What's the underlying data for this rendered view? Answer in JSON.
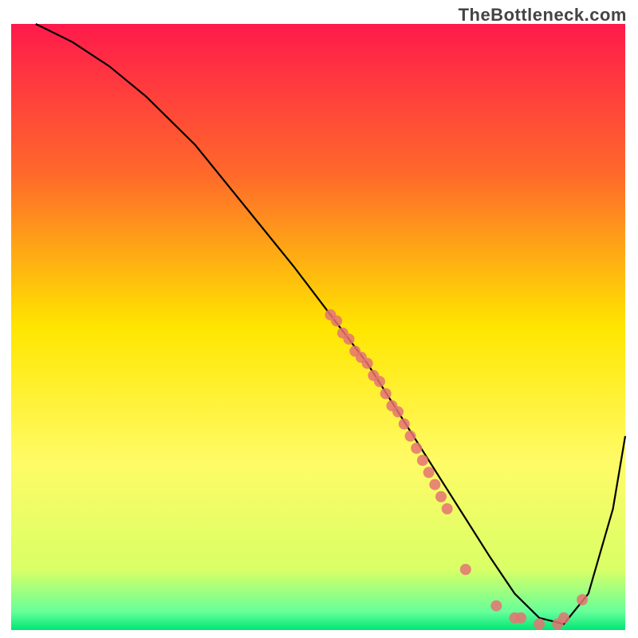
{
  "watermark": "TheBottleneck.com",
  "chart_data": {
    "type": "line",
    "title": "",
    "xlabel": "",
    "ylabel": "",
    "xlim": [
      0,
      100
    ],
    "ylim": [
      0,
      100
    ],
    "background_gradient": {
      "stops": [
        {
          "offset": 0.0,
          "color": "#ff1a4b"
        },
        {
          "offset": 0.25,
          "color": "#ff6a2a"
        },
        {
          "offset": 0.5,
          "color": "#ffe600"
        },
        {
          "offset": 0.72,
          "color": "#fffb66"
        },
        {
          "offset": 0.9,
          "color": "#d9ff66"
        },
        {
          "offset": 0.97,
          "color": "#66ff99"
        },
        {
          "offset": 1.0,
          "color": "#00e676"
        }
      ]
    },
    "series": [
      {
        "name": "bottleneck-curve",
        "type": "line",
        "x": [
          4,
          10,
          16,
          22,
          30,
          38,
          46,
          52,
          58,
          63,
          68,
          73,
          78,
          82,
          86,
          90,
          94,
          98,
          100
        ],
        "y": [
          100,
          97,
          93,
          88,
          80,
          70,
          60,
          52,
          44,
          36,
          28,
          20,
          12,
          6,
          2,
          1,
          6,
          20,
          32
        ]
      },
      {
        "name": "highlight-points-mid",
        "type": "scatter",
        "x": [
          52,
          53,
          54,
          55,
          56,
          57,
          58,
          59,
          60,
          61,
          62,
          63,
          64,
          65,
          66,
          67,
          68,
          69,
          70,
          71
        ],
        "y": [
          52,
          51,
          49,
          48,
          46,
          45,
          44,
          42,
          41,
          39,
          37,
          36,
          34,
          32,
          30,
          28,
          26,
          24,
          22,
          20
        ]
      },
      {
        "name": "highlight-points-low",
        "type": "scatter",
        "x": [
          74,
          79,
          82,
          83,
          86,
          89,
          90,
          93
        ],
        "y": [
          10,
          4,
          2,
          2,
          1,
          1,
          2,
          5
        ]
      }
    ]
  }
}
